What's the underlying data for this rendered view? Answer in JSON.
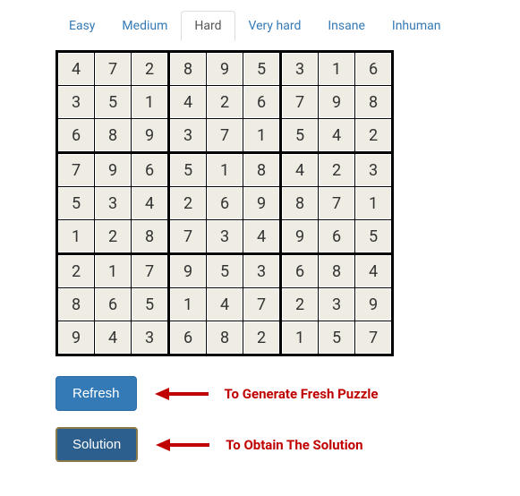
{
  "tabs": {
    "items": [
      "Easy",
      "Medium",
      "Hard",
      "Very hard",
      "Insane",
      "Inhuman"
    ],
    "active_index": 2
  },
  "chart_data": {
    "type": "table",
    "title": "Sudoku board (solved, Hard)",
    "rows": [
      [
        4,
        7,
        2,
        8,
        9,
        5,
        3,
        1,
        6
      ],
      [
        3,
        5,
        1,
        4,
        2,
        6,
        7,
        9,
        8
      ],
      [
        6,
        8,
        9,
        3,
        7,
        1,
        5,
        4,
        2
      ],
      [
        7,
        9,
        6,
        5,
        1,
        8,
        4,
        2,
        3
      ],
      [
        5,
        3,
        4,
        2,
        6,
        9,
        8,
        7,
        1
      ],
      [
        1,
        2,
        8,
        7,
        3,
        4,
        9,
        6,
        5
      ],
      [
        2,
        1,
        7,
        9,
        5,
        3,
        6,
        8,
        4
      ],
      [
        8,
        6,
        5,
        1,
        4,
        7,
        2,
        3,
        9
      ],
      [
        9,
        4,
        3,
        6,
        8,
        2,
        1,
        5,
        7
      ]
    ]
  },
  "controls": {
    "refresh_label": "Refresh",
    "refresh_hint": "To Generate Fresh Puzzle",
    "solution_label": "Solution",
    "solution_hint": "To Obtain The Solution"
  },
  "colors": {
    "link": "#337ab7",
    "hint": "#c00000",
    "cell_bg": "#efece3"
  }
}
